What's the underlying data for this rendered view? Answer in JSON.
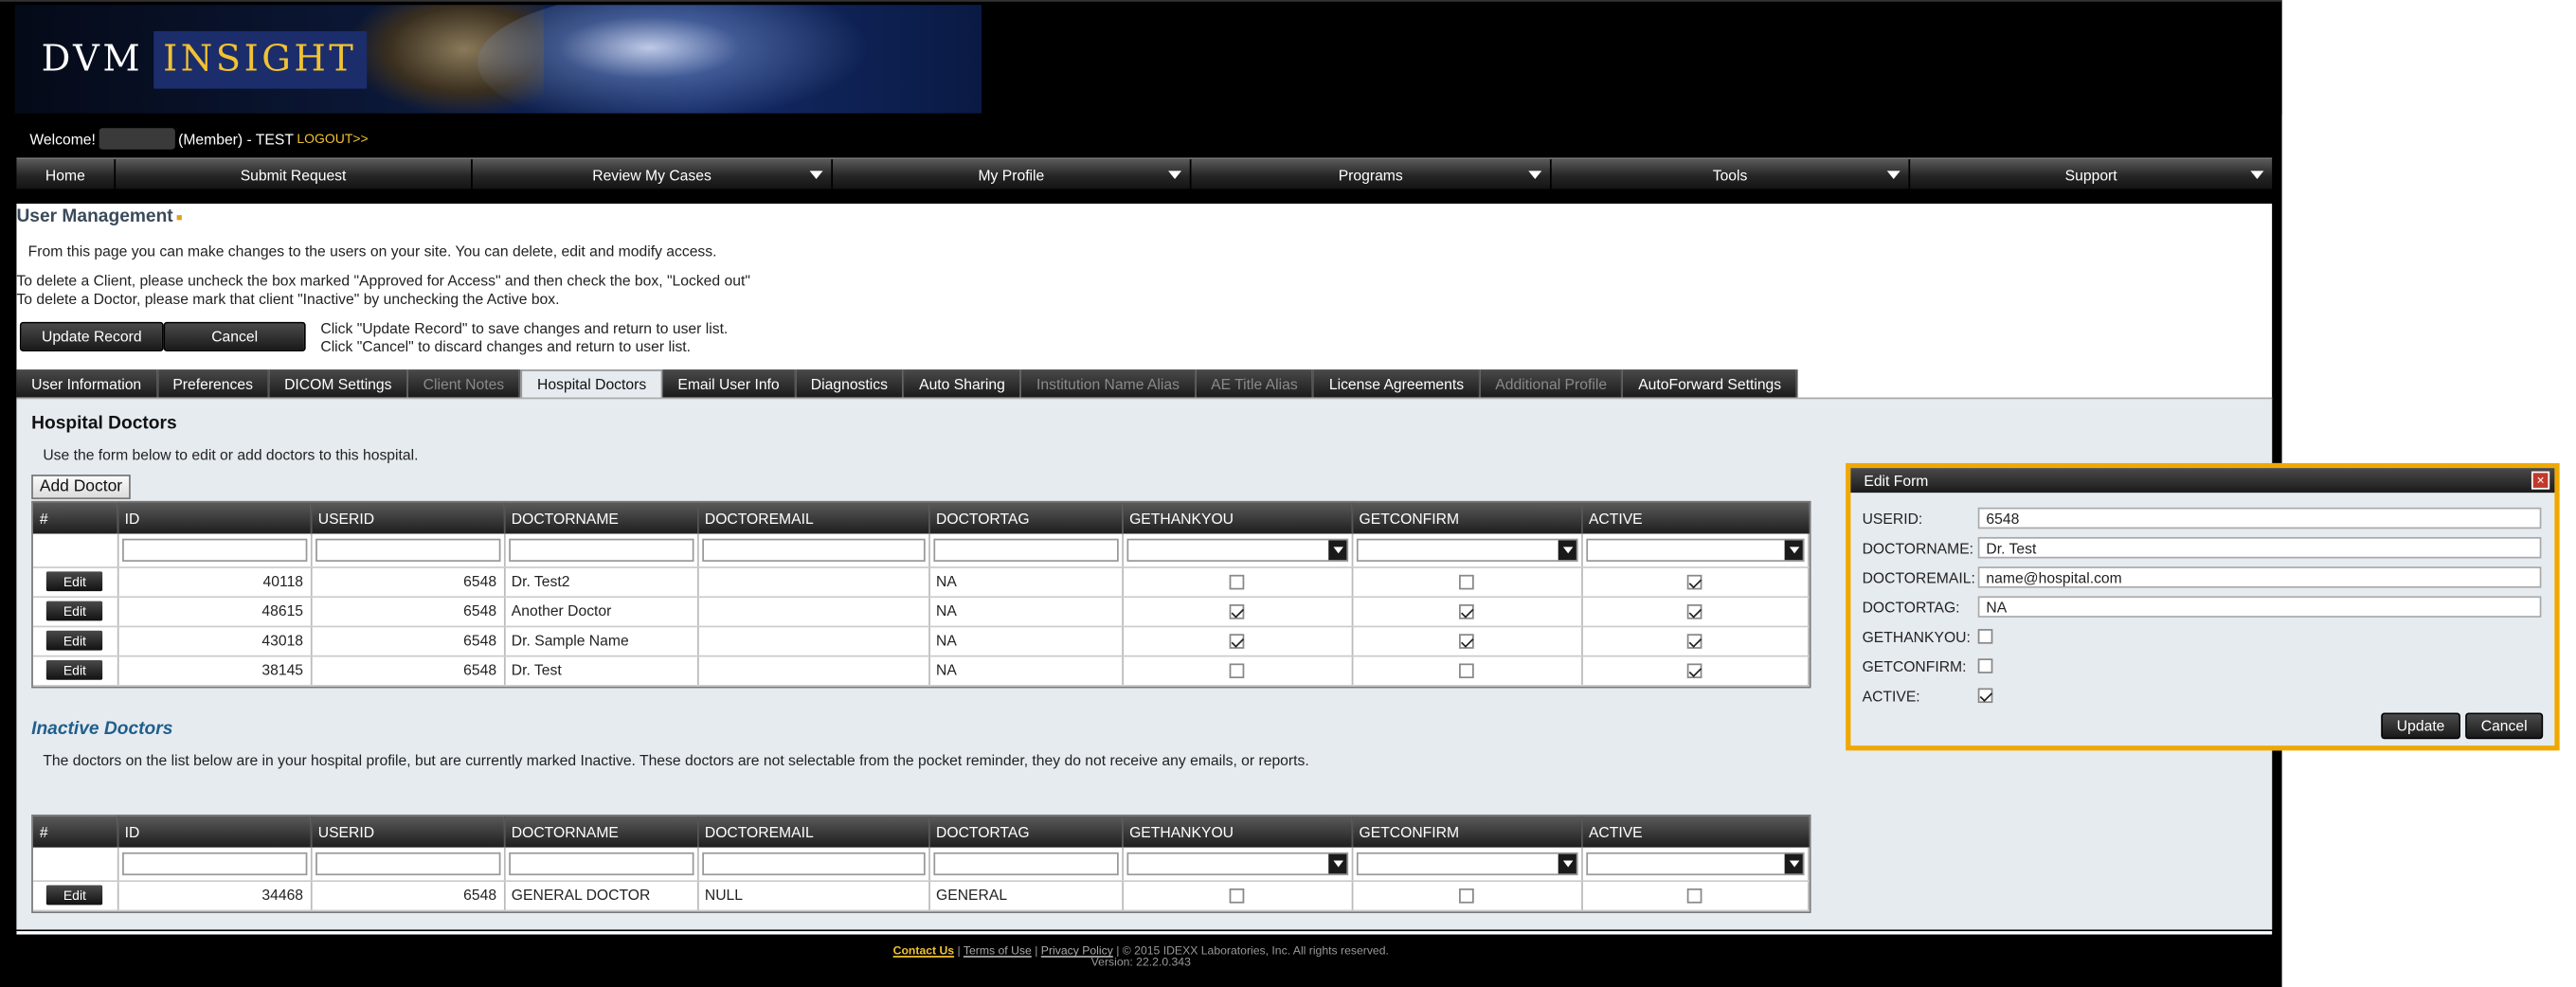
{
  "brand": {
    "logo_left": "DVM",
    "logo_right": "INSIGHT"
  },
  "header": {
    "welcome": "Welcome!",
    "role": "(Member) - TEST",
    "logout": "LOGOUT>>"
  },
  "nav": [
    {
      "label": "Home",
      "dropdown": false
    },
    {
      "label": "Submit Request",
      "dropdown": false
    },
    {
      "label": "Review My Cases",
      "dropdown": true
    },
    {
      "label": "My Profile",
      "dropdown": true
    },
    {
      "label": "Programs",
      "dropdown": true
    },
    {
      "label": "Tools",
      "dropdown": true
    },
    {
      "label": "Support",
      "dropdown": true
    }
  ],
  "page": {
    "title": "User Management",
    "intro": "From this page you can make changes to the users on your site. You can delete, edit and modify access.",
    "note1": "To delete a Client, please uncheck the box marked \"Approved for Access\" and then check the box, \"Locked out\"",
    "note2": "To delete a Doctor, please mark that client \"Inactive\" by unchecking the Active box.",
    "update_button": "Update Record",
    "cancel_button": "Cancel",
    "hint1": "Click \"Update Record\" to save changes and return to user list.",
    "hint2": "Click \"Cancel\" to discard changes and return to user list."
  },
  "tabs": [
    {
      "label": "User Information",
      "state": "normal"
    },
    {
      "label": "Preferences",
      "state": "normal"
    },
    {
      "label": "DICOM Settings",
      "state": "normal"
    },
    {
      "label": "Client Notes",
      "state": "disabled"
    },
    {
      "label": "Hospital Doctors",
      "state": "active"
    },
    {
      "label": "Email User Info",
      "state": "normal"
    },
    {
      "label": "Diagnostics",
      "state": "normal"
    },
    {
      "label": "Auto Sharing",
      "state": "normal"
    },
    {
      "label": "Institution Name Alias",
      "state": "disabled"
    },
    {
      "label": "AE Title Alias",
      "state": "disabled"
    },
    {
      "label": "License Agreements",
      "state": "normal"
    },
    {
      "label": "Additional Profile",
      "state": "disabled"
    },
    {
      "label": "AutoForward Settings",
      "state": "normal"
    }
  ],
  "hospital_doctors": {
    "title": "Hospital Doctors",
    "instructions": "Use the form below to edit or add doctors to this hospital.",
    "add_button": "Add Doctor",
    "columns": [
      "#",
      "ID",
      "USERID",
      "DOCTORNAME",
      "DOCTOREMAIL",
      "DOCTORTAG",
      "GETHANKYOU",
      "GETCONFIRM",
      "ACTIVE"
    ],
    "edit_label": "Edit",
    "rows": [
      {
        "id": "40118",
        "userid": "6548",
        "name": "Dr. Test2",
        "email": "",
        "tag": "NA",
        "thankyou": false,
        "confirm": false,
        "active": true
      },
      {
        "id": "48615",
        "userid": "6548",
        "name": "Another Doctor",
        "email": "",
        "tag": "NA",
        "thankyou": true,
        "confirm": true,
        "active": true
      },
      {
        "id": "43018",
        "userid": "6548",
        "name": "Dr. Sample Name",
        "email": "",
        "tag": "NA",
        "thankyou": true,
        "confirm": true,
        "active": true
      },
      {
        "id": "38145",
        "userid": "6548",
        "name": "Dr. Test",
        "email": "",
        "tag": "NA",
        "thankyou": false,
        "confirm": false,
        "active": true
      }
    ]
  },
  "inactive_doctors": {
    "title": "Inactive Doctors",
    "description": "The doctors on the list below are in your hospital profile, but are currently marked Inactive. These doctors are not selectable from the pocket reminder, they do not receive any emails, or reports.",
    "rows": [
      {
        "id": "34468",
        "userid": "6548",
        "name": "GENERAL DOCTOR",
        "email": "NULL",
        "tag": "GENERAL",
        "thankyou": false,
        "confirm": false,
        "active": false
      }
    ]
  },
  "edit_form": {
    "title": "Edit Form",
    "close": "×",
    "userid_label": "USERID:",
    "userid_value": "6548",
    "name_label": "DOCTORNAME:",
    "name_value": "Dr. Test",
    "email_label": "DOCTOREMAIL:",
    "email_value": "name@hospital.com",
    "tag_label": "DOCTORTAG:",
    "tag_value": "NA",
    "thankyou_label": "GETHANKYOU:",
    "thankyou_checked": false,
    "confirm_label": "GETCONFIRM:",
    "confirm_checked": false,
    "active_label": "ACTIVE:",
    "active_checked": true,
    "update_button": "Update",
    "cancel_button": "Cancel"
  },
  "footer": {
    "contact": "Contact Us",
    "sep": "|",
    "terms": "Terms of Use",
    "privacy": "Privacy Policy",
    "copyright": "| © 2015 IDEXX Laboratories, Inc. All rights reserved.",
    "version": "Version: 22.2.0.343"
  },
  "colors": {
    "accent": "#f1c232",
    "highlight_border": "#f0a800",
    "panel": "#e6ebf0"
  }
}
